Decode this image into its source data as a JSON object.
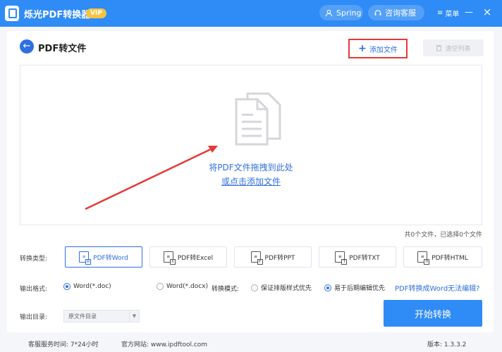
{
  "app": {
    "title": "烁光PDF转换器",
    "vip": "VIP"
  },
  "header": {
    "user": "Spring",
    "support": "咨询客服",
    "menu": "菜单",
    "minimize": "—",
    "close": "×"
  },
  "page": {
    "back": "←",
    "title": "PDF转文件",
    "add_file": "添加文件",
    "clear_list": "清空列表"
  },
  "dropzone": {
    "text": "将PDF文件拖拽到此处",
    "link": "或点击添加文件"
  },
  "file_count": "共0个文件，已选择0个文件",
  "conversion": {
    "label": "转换类型:",
    "types": [
      {
        "label": "PDF转Word",
        "badge": "W",
        "active": true
      },
      {
        "label": "PDF转Excel",
        "badge": "X",
        "active": false
      },
      {
        "label": "PDF转PPT",
        "badge": "P",
        "active": false
      },
      {
        "label": "PDF转TXT",
        "badge": "T",
        "active": false
      },
      {
        "label": "PDF转HTML",
        "badge": "H",
        "active": false
      }
    ]
  },
  "output_format": {
    "label": "输出格式:",
    "options": [
      "Word(*.doc)",
      "Word(*.docx)"
    ],
    "selected": "Word(*.doc)",
    "mode_label": "转换模式:",
    "modes": [
      "保证排版样式优先",
      "易于后期编辑优先"
    ],
    "selected_mode": "易于后期编辑优先",
    "help_link": "PDF转换成Word无法编辑?"
  },
  "output_dir": {
    "label": "输出目录:",
    "value": "原文件目录"
  },
  "start_button": "开始转换",
  "footer": {
    "service": "客服服务时间: 7*24小时",
    "website": "官方网站:  www.ipdftool.com",
    "version": "版本:  1.3.3.2"
  },
  "colors": {
    "primary": "#2f8bf5",
    "accent": "#2f6fe0",
    "highlight": "#e53935",
    "vip": "#f5c342"
  }
}
